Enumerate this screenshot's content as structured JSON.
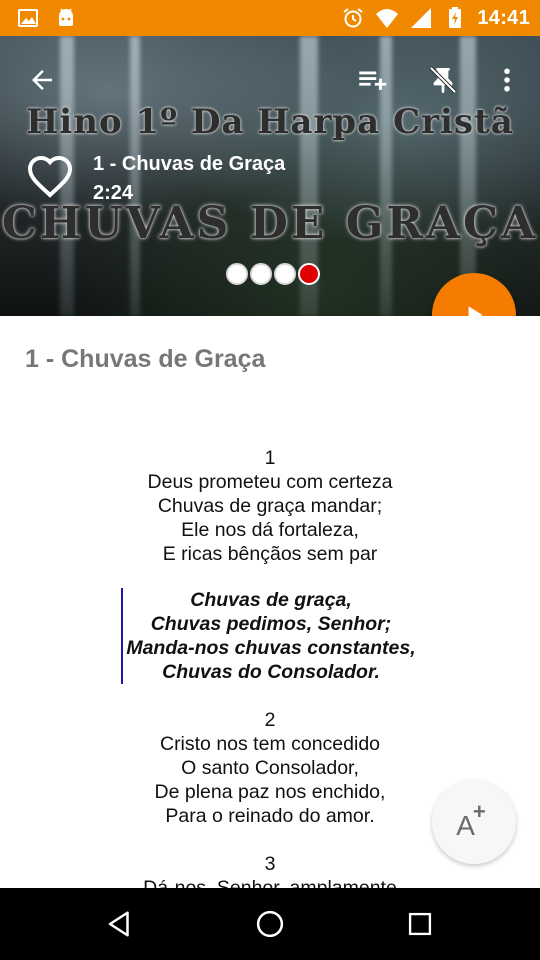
{
  "status_bar": {
    "time": "14:41",
    "icons_left": [
      "image-icon",
      "android-icon"
    ],
    "icons_right": [
      "alarm-icon",
      "wifi-icon",
      "signal-icon",
      "battery-charging-icon"
    ],
    "color": "#F08800"
  },
  "header": {
    "watermark_line1": "Hino 1º Da Harpa Cristã",
    "watermark_line2": "CHUVAS DE GRAÇA",
    "song_title": "1 - Chuvas de Graça",
    "duration": "2:24",
    "actions": [
      "back-arrow-icon",
      "playlist-add-icon",
      "pin-off-icon",
      "more-vert-icon"
    ],
    "pager_dots": 4,
    "active_dot_index": 3
  },
  "content": {
    "title": "1 - Chuvas de Graça",
    "verses": [
      {
        "number": "1",
        "lines": [
          "Deus prometeu com certeza",
          "Chuvas de graça mandar;",
          "Ele nos dá fortaleza,",
          "E ricas bênçãos sem par"
        ]
      },
      {
        "number": "2",
        "lines": [
          "Cristo nos tem concedido",
          "O santo Consolador,",
          "De plena paz nos enchido,",
          "Para o reinado do amor."
        ]
      },
      {
        "number": "3",
        "lines": [
          "Dá-nos, Senhor, amplamente"
        ]
      }
    ],
    "chorus": [
      "Chuvas de graça,",
      "Chuvas pedimos, Senhor;",
      "Manda-nos chuvas constantes,",
      "Chuvas do Consolador."
    ]
  },
  "fab": {
    "play_icon": "play-icon",
    "font_label": "A",
    "font_plus": "+"
  },
  "nav": [
    "back-triangle-icon",
    "home-circle-icon",
    "recents-square-icon"
  ],
  "colors": {
    "accent": "#F57C00",
    "chorus_bar": "#1a1aa8",
    "active_dot": "#E00000"
  }
}
